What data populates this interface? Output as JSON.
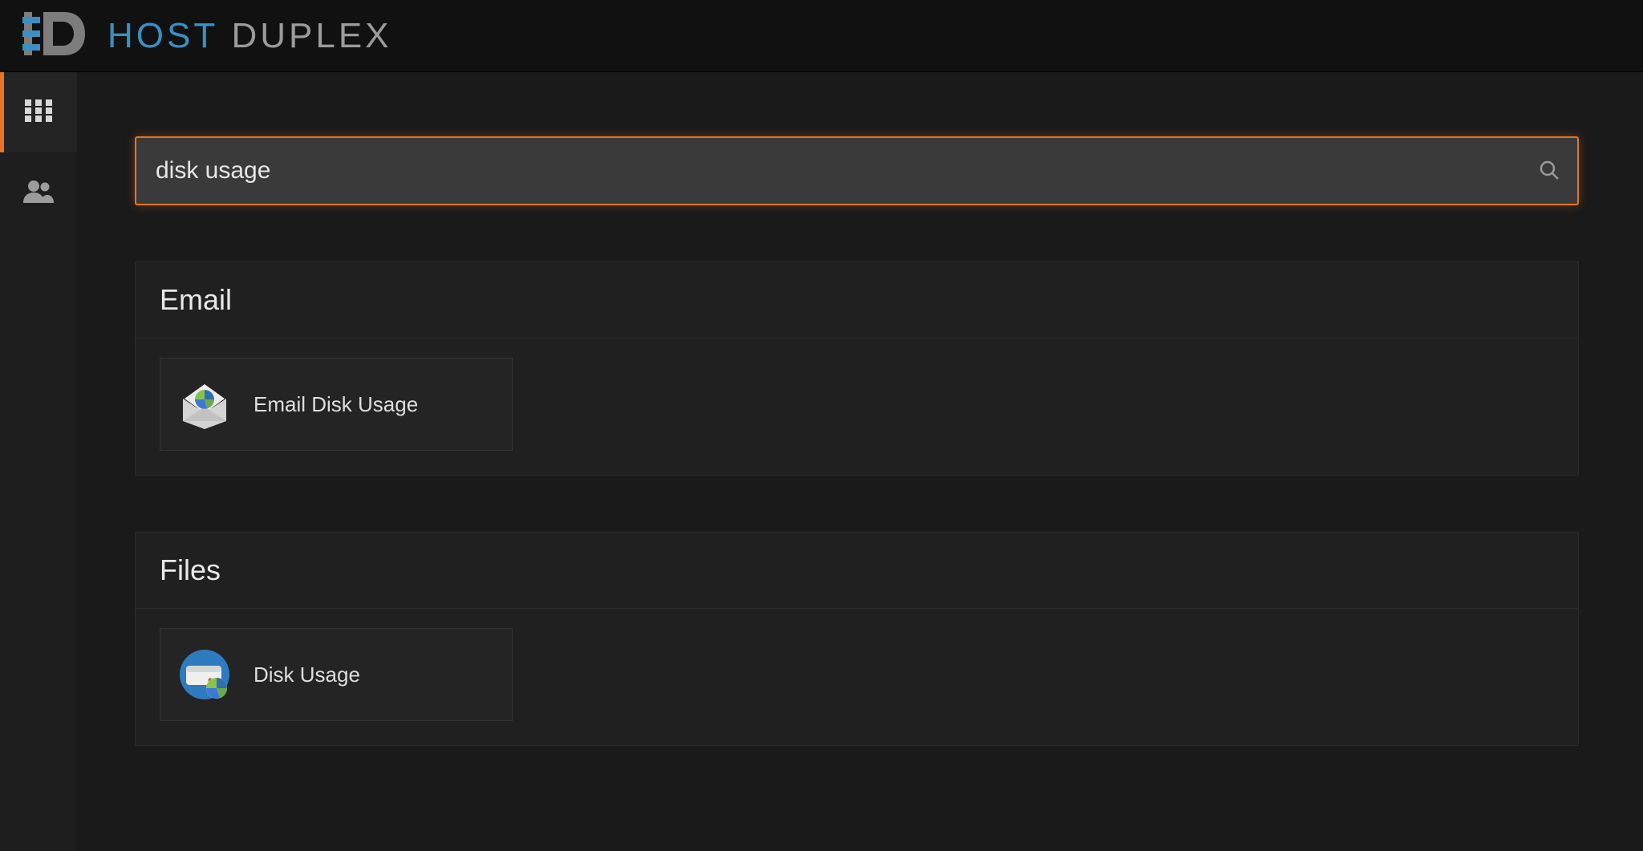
{
  "brand": {
    "host": "HOST",
    "duplex": "DUPLEX"
  },
  "sidebar": {
    "items": [
      {
        "name": "apps-grid-icon",
        "active": true
      },
      {
        "name": "users-icon",
        "active": false
      }
    ]
  },
  "search": {
    "value": "disk usage",
    "placeholder": ""
  },
  "sections": [
    {
      "title": "Email",
      "items": [
        {
          "label": "Email Disk Usage",
          "icon": "email-disk-usage-icon"
        }
      ]
    },
    {
      "title": "Files",
      "items": [
        {
          "label": "Disk Usage",
          "icon": "disk-usage-icon"
        }
      ]
    }
  ]
}
